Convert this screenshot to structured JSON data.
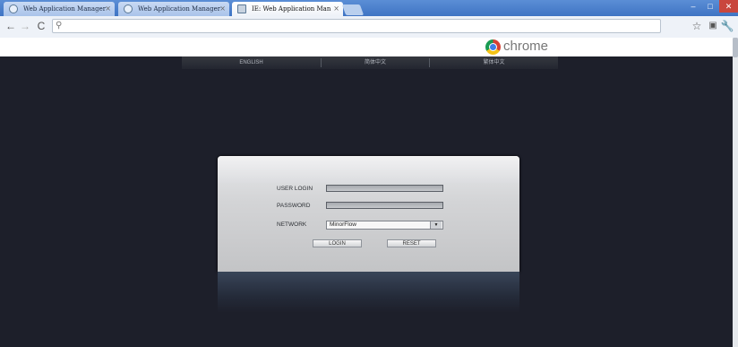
{
  "browser": {
    "tabs": [
      {
        "label": "Web Application Manager",
        "active": false
      },
      {
        "label": "Web Application Manager",
        "active": false
      },
      {
        "label": "IE: Web Application Man",
        "active": true
      }
    ],
    "tab_close_glyph": "×",
    "brand_word": "chrome",
    "icons": [
      "back-icon",
      "forward-icon",
      "reload-icon",
      "search-icon",
      "star-icon",
      "page-icon",
      "wrench-icon",
      "chrome-logo-icon"
    ]
  },
  "page": {
    "language_bar": {
      "items": [
        "ENGLISH",
        "简体中文",
        "繁体中文"
      ]
    },
    "login": {
      "user_label": "USER LOGIN",
      "password_label": "PASSWORD",
      "network_label": "NETWORK",
      "network_value": "MinorFlow",
      "login_button": "LOGIN",
      "reset_button": "RESET"
    }
  },
  "colors": {
    "page_background": "#1d1f2a",
    "tabstrip": "#3f74c4",
    "panel": "#d3d4d6"
  }
}
